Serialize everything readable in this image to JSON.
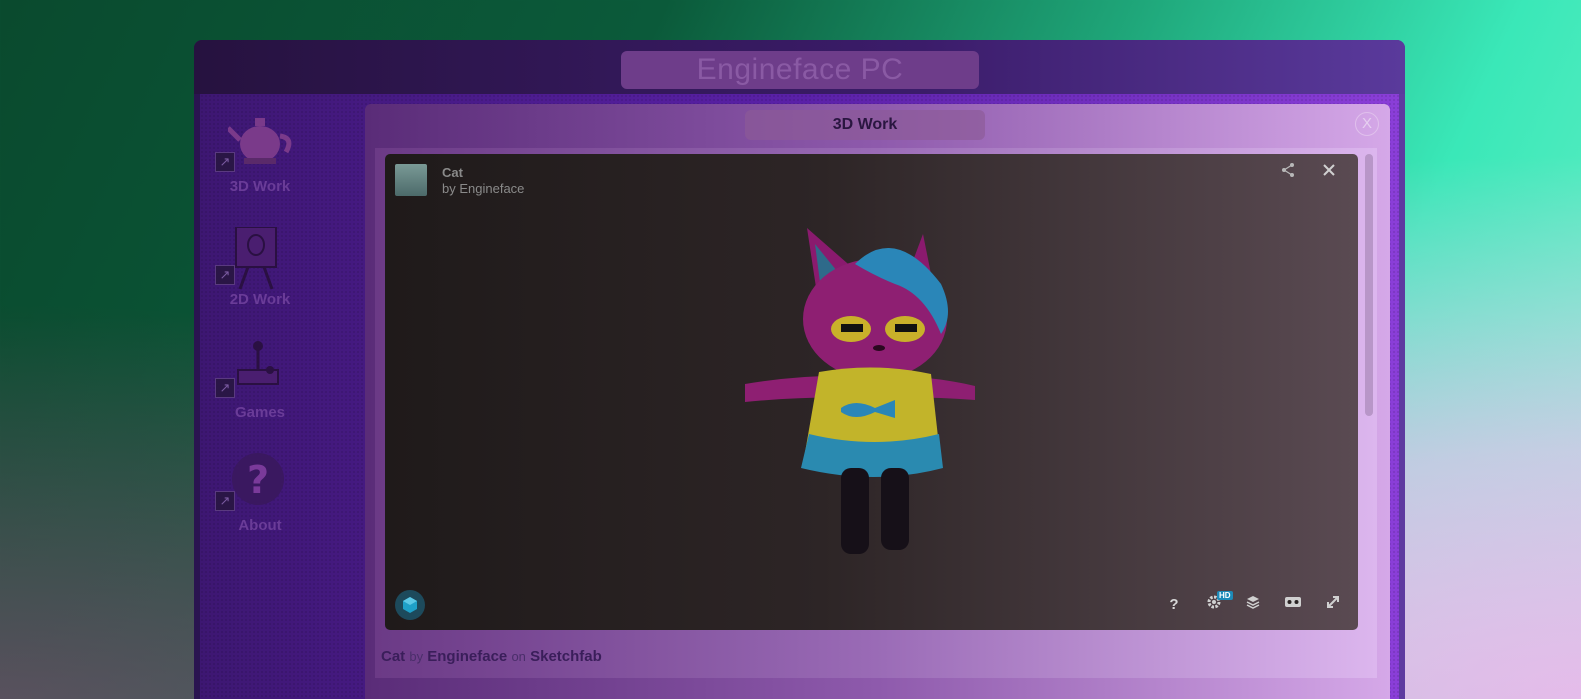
{
  "window": {
    "title": "Engineface PC"
  },
  "desktop": {
    "icons": [
      {
        "label": "3D Work",
        "icon": "teapot-icon"
      },
      {
        "label": "2D Work",
        "icon": "easel-icon"
      },
      {
        "label": "Games",
        "icon": "joystick-icon"
      },
      {
        "label": "About",
        "icon": "question-icon"
      }
    ]
  },
  "app": {
    "title": "3D Work",
    "close_label": "X",
    "viewer": {
      "model_title": "Cat",
      "author_prefix": "by",
      "author": "Engineface",
      "help_label": "?",
      "hd_badge": "HD"
    },
    "credit": {
      "model": "Cat",
      "by": "by",
      "author": "Engineface",
      "on": "on",
      "platform": "Sketchfab"
    }
  },
  "colors": {
    "accent": "#8a3ed8",
    "hd_badge": "#1d8ab8"
  }
}
